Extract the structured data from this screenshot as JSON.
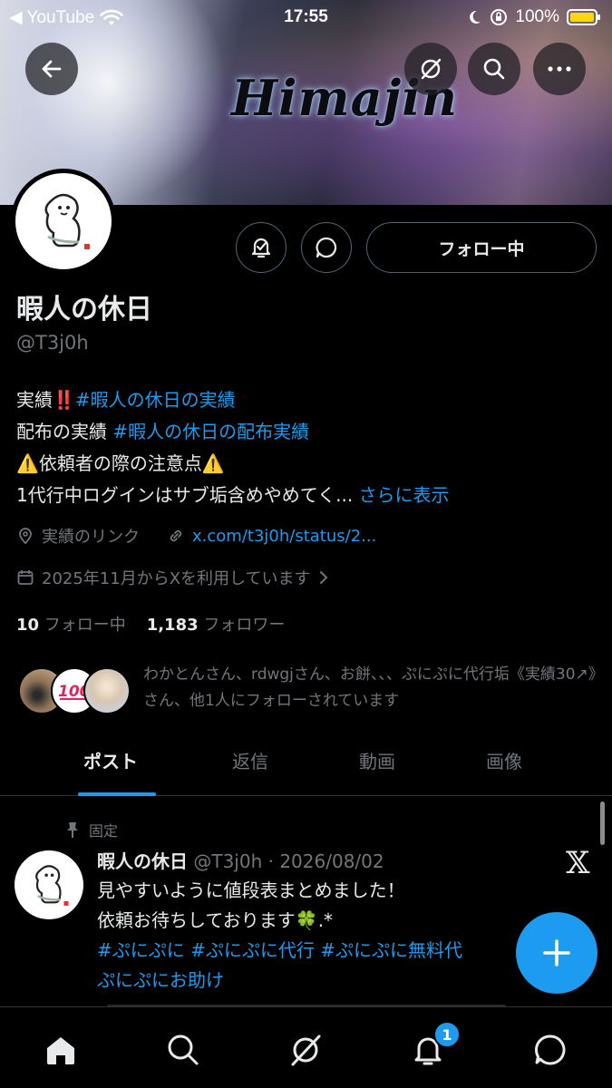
{
  "status_bar": {
    "back_app": "◀ YouTube",
    "time": "17:55",
    "battery": "100%"
  },
  "banner": {
    "text": "Himajin"
  },
  "profile": {
    "name": "暇人の休日",
    "handle": "@T3j0h",
    "follow_label": "フォロー中",
    "bio": {
      "line1_prefix": "実績",
      "line1_emoji": "‼️",
      "line1_tag": "#暇人の休日の実績",
      "line2_prefix": "配布の実績 ",
      "line2_tag": "#暇人の休日の配布実績",
      "line3": "⚠️依頼者の際の注意点⚠️",
      "line4": "1代行中ログインはサブ垢含めやめてく...",
      "show_more": "さらに表示"
    },
    "location": "実績のリンク",
    "url": "x.com/t3j0h/status/2...",
    "joined": "2025年11月からXを利用しています",
    "following_count": "10",
    "following_label": "フォロー中",
    "followers_count": "1,183",
    "followers_label": "フォロワー",
    "followed_by": "わかとんさん、rdwgjさん、お餅、、、ぷにぷに代行垢《実績30↗》さん、他1人にフォローされています"
  },
  "tabs": [
    {
      "label": "ポスト",
      "active": true
    },
    {
      "label": "返信",
      "active": false
    },
    {
      "label": "動画",
      "active": false
    },
    {
      "label": "画像",
      "active": false
    }
  ],
  "post": {
    "pinned_label": "固定",
    "author": "暇人の休日",
    "meta": "@T3j0h · 2026/08/02",
    "line1": "見やすいように値段表まとめました！",
    "line2": "依頼お待ちしております🍀.*",
    "tags_line1": " #ぷにぷに  #ぷにぷに代行  #ぷにぷに無料代",
    "tags_line2": "ぷにぷにお助け"
  },
  "notifications_badge": "1",
  "colors": {
    "accent": "#1d9bf0",
    "muted": "#71767b",
    "text": "#e7e9ea",
    "background": "#000000",
    "battery": "#ffd60a"
  },
  "icons": [
    "back-arrow-icon",
    "grok-icon",
    "search-icon",
    "more-icon",
    "notify-bell-icon",
    "message-icon",
    "location-icon",
    "link-icon",
    "calendar-icon",
    "chevron-right-icon",
    "pin-icon",
    "x-logo-icon",
    "plus-icon",
    "home-icon",
    "search-nav-icon",
    "grok-nav-icon",
    "bell-icon",
    "chat-icon"
  ]
}
